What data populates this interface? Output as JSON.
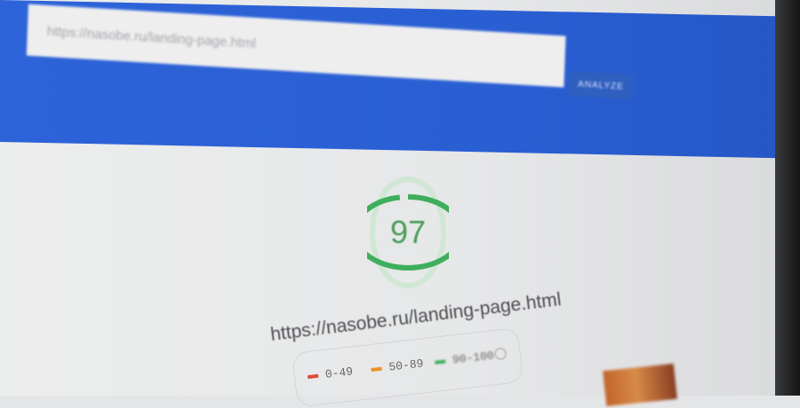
{
  "search": {
    "url_value": "https://nasobe.ru/landing-page.html",
    "analyze_label": "ANALYZE"
  },
  "report": {
    "score": "97",
    "score_color": "#4a9d5a",
    "gauge_fraction": 0.97,
    "url": "https://nasobe.ru/landing-page.html"
  },
  "legend": {
    "items": [
      {
        "label": "0-49",
        "color": "#e04a3c"
      },
      {
        "label": "50-89",
        "color": "#ef8f2a"
      },
      {
        "label": "90-100",
        "color": "#3fae5c"
      }
    ],
    "info_icon": "info-icon"
  },
  "colors": {
    "header_blue": "#2d63d8",
    "page_background": "#eceded"
  }
}
